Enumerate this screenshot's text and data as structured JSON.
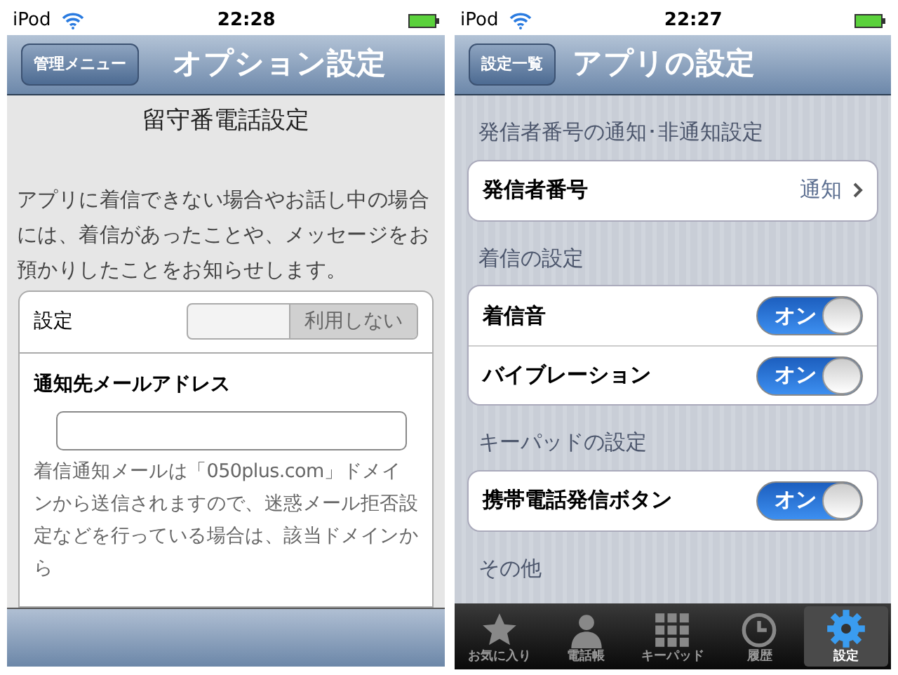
{
  "screens": [
    {
      "status_bar": {
        "carrier": "iPod",
        "time": "22:28"
      },
      "nav_bar": {
        "back": "管理メニュー",
        "title": "オプション設定"
      },
      "heading": "留守番電話設定",
      "description": "アプリに着信できない場合やお話し中の場合には、着信があったことや、メッセージをお預かりしたことをお知らせします。",
      "setting": {
        "label": "設定",
        "toggle_label": "利用しない",
        "on": false
      },
      "email": {
        "label": "通知先メールアドレス",
        "note": "着信通知メールは「050plus.com」ドメインから送信されますので、迷惑メール拒否設定などを行っている場合は、該当ドメインから"
      }
    },
    {
      "status_bar": {
        "carrier": "iPod",
        "time": "22:27"
      },
      "nav_bar": {
        "back": "設定一覧",
        "title": "アプリの設定"
      },
      "sections": [
        {
          "header": "発信者番号の通知･非通知設定",
          "rows": [
            {
              "kind": "link",
              "label": "発信者番号",
              "value": "通知"
            }
          ]
        },
        {
          "header": "着信の設定",
          "rows": [
            {
              "kind": "switch",
              "label": "着信音",
              "value": "オン",
              "on": true
            },
            {
              "kind": "switch",
              "label": "バイブレーション",
              "value": "オン",
              "on": true
            }
          ]
        },
        {
          "header": "キーパッドの設定",
          "rows": [
            {
              "kind": "switch",
              "label": "携帯電話発信ボタン",
              "value": "オン",
              "on": true
            }
          ]
        },
        {
          "header": "その他"
        }
      ],
      "tab_bar": [
        {
          "label": "お気に入り",
          "kind": "star",
          "selected": false
        },
        {
          "label": "電話帳",
          "kind": "person",
          "selected": false
        },
        {
          "label": "キーパッド",
          "kind": "keypad",
          "selected": false
        },
        {
          "label": "履歴",
          "kind": "clock",
          "selected": false
        },
        {
          "label": "設定",
          "kind": "gear",
          "selected": true
        }
      ]
    }
  ]
}
